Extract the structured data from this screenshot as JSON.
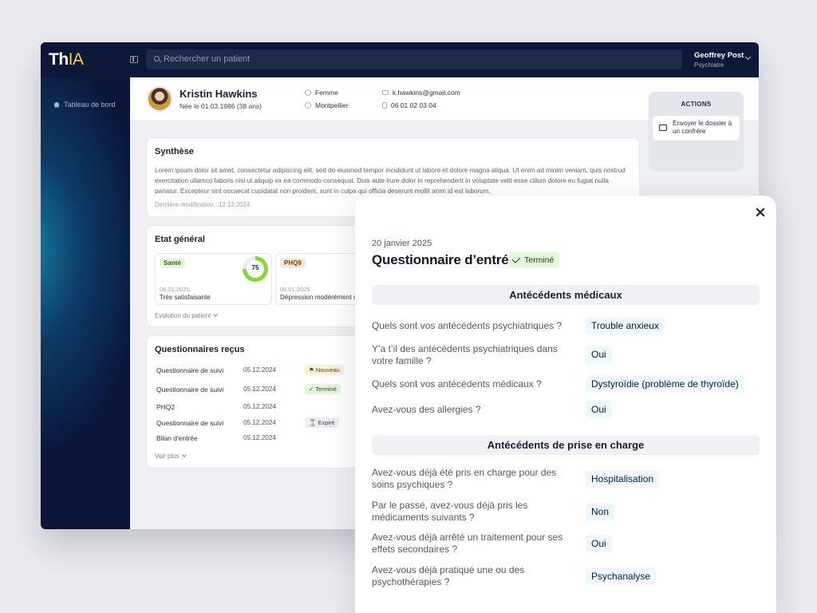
{
  "app": {
    "logo_main": "Th",
    "logo_accent": "IA",
    "search_placeholder": "Rechercher un patient",
    "user": {
      "name": "Geoffrey Post",
      "role": "Psychiatre"
    },
    "nav": [
      {
        "label": "Tableau de bord",
        "icon": "home-icon"
      }
    ]
  },
  "patient": {
    "name": "Kristin Hawkins",
    "birth": "Née le 01.03.1986 (38 ans)",
    "gender": "Femme",
    "city": "Montpellier",
    "email": "k.hawkins@gmail.com",
    "phone": "06 01 02 03 04"
  },
  "synthese": {
    "title": "Synthèse",
    "text": "Lorem ipsum dolor sit amet, consectetur adipiscing elit, sed do eiusmod tempor incididunt ut labore et dolore magna aliqua. Ut enim ad minim veniam, quis nostrud exercitation ullamco laboris nisi ut aliquip ex ea commodo consequat. Duis aute irure dolor in reprehenderit in voluptate velit esse cillum dolore eu fugiat nulla pariatur. Excepteur sint occaecat cupidatat non proident, sunt in culpa qui officia deserunt mollit anim id est laborum.",
    "last_modified": "Dernière modification : 12.12.2024"
  },
  "etat": {
    "title": "Etat général",
    "cards": [
      {
        "tag": "Santé",
        "date": "06.01.2025",
        "value": "Très satisfaisante",
        "score": 75
      },
      {
        "tag": "PHQ9",
        "date": "06.01.2025",
        "value": "Dépression modérément sévère"
      }
    ],
    "evolution_link": "Evolution du patient"
  },
  "questionnaires": {
    "title": "Questionnaires reçus",
    "rows": [
      {
        "name": "Questionnaire de suivi",
        "date": "05.12.2024",
        "status": "Nouveau",
        "status_icon": "flag-icon"
      },
      {
        "name": "Questionnaire de suivi",
        "date": "05.12.2024",
        "status": "Terminé",
        "status_icon": "check-icon"
      },
      {
        "name": "PHQ2",
        "date": "05.12.2024",
        "status": ""
      },
      {
        "name": "Questionnaire de suivi",
        "date": "05.12.2024",
        "status": "Expiré",
        "status_icon": "hourglass-icon"
      },
      {
        "name": "Bilan d'entrée",
        "date": "05.12.2024",
        "status": ""
      }
    ],
    "more": "Voir plus"
  },
  "actions": {
    "title": "ACTIONS",
    "send_dossier": "Envoyer le dossier à un confrère"
  },
  "panel": {
    "date": "20 janvier 2025",
    "title": "Questionnaire d’entrée",
    "status": "Terminé",
    "sections": [
      {
        "title": "Antécédents médicaux",
        "items": [
          {
            "q": "Quels sont vos antécédents psychiatriques ?",
            "a": "Trouble anxieux"
          },
          {
            "q": "Y’a t’il des antécédents psychiatriques dans votre famille ?",
            "a": "Oui"
          },
          {
            "q": "Quels sont vos antécédents médicaux ?",
            "a": "Dystyroïdie (problème de thyroïde)"
          },
          {
            "q": "Avez-vous des allergies ?",
            "a": "Oui"
          }
        ]
      },
      {
        "title": "Antécédents de prise en charge",
        "items": [
          {
            "q": "Avez-vous déjà été pris en charge pour des soins psychiques ?",
            "a": "Hospitalisation"
          },
          {
            "q": "Par le passé, avez-vous déjà pris les médicaments suivants ?",
            "a": "Non"
          },
          {
            "q": "Avez-vous déjà arrêté un traitement pour ses effets secondaires ?",
            "a": "Oui"
          },
          {
            "q": "Avez-vous déjà pratiqué une ou des psychothérapies ?",
            "a": "Psychanalyse"
          }
        ]
      }
    ]
  },
  "colors": {
    "sidebar": "#0b1639",
    "accent": "#f4c95d",
    "success": "#86d637"
  }
}
